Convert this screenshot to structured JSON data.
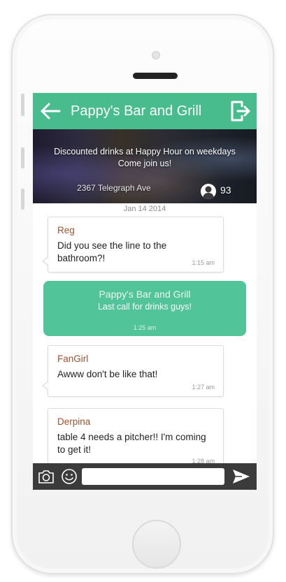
{
  "header": {
    "title": "Pappy's Bar and Grill",
    "back_icon": "arrow-left-icon",
    "logout_icon": "logout-icon"
  },
  "banner": {
    "line1": "Discounted drinks at Happy Hour on weekdays",
    "line2": "Come join us!",
    "address": "2367 Telegraph Ave",
    "member_count": "93",
    "member_icon": "person-icon"
  },
  "chat": {
    "date": "Jan 14 2014",
    "messages": [
      {
        "sender": "Reg",
        "text": "Did you see the line to the bathroom?!",
        "time": "1:15 am"
      },
      {
        "sender": "Pappy's Bar and Grill",
        "text": "Last call for drinks guys!",
        "time": "1:25 am",
        "own": true
      },
      {
        "sender": "FanGirl",
        "text": "Awww don't be like that!",
        "time": "1:27 am"
      },
      {
        "sender": "Derpina",
        "text": "table 4 needs a pitcher!! I'm coming to get it!",
        "time": "1:28 am"
      }
    ]
  },
  "input_bar": {
    "camera_icon": "camera-icon",
    "emoji_icon": "smiley-icon",
    "placeholder": "",
    "send_icon": "send-icon"
  },
  "colors": {
    "accent": "#49bc8e",
    "own_bubble": "#52c499",
    "sender_name": "#a0522d",
    "input_bar": "#3b3b3b"
  }
}
